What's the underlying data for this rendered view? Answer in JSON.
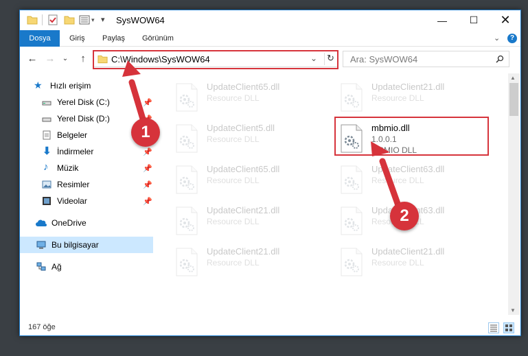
{
  "window": {
    "title": "SysWOW64"
  },
  "ribbon": {
    "tabs": [
      "Dosya",
      "Giriş",
      "Paylaş",
      "Görünüm"
    ]
  },
  "address": {
    "path": "C:\\Windows\\SysWOW64"
  },
  "search": {
    "placeholder": "Ara: SysWOW64"
  },
  "sidebar": {
    "items": [
      {
        "label": "Hızlı erişim",
        "icon": "star-icon",
        "pinned": false
      },
      {
        "label": "Yerel Disk (C:)",
        "icon": "drive-icon",
        "pinned": true
      },
      {
        "label": "Yerel Disk (D:)",
        "icon": "drive-icon",
        "pinned": true
      },
      {
        "label": "Belgeler",
        "icon": "documents-icon",
        "pinned": true
      },
      {
        "label": "İndirmeler",
        "icon": "download-icon",
        "pinned": true
      },
      {
        "label": "Müzik",
        "icon": "music-icon",
        "pinned": true
      },
      {
        "label": "Resimler",
        "icon": "pictures-icon",
        "pinned": true
      },
      {
        "label": "Videolar",
        "icon": "videos-icon",
        "pinned": true
      },
      {
        "label": "OneDrive",
        "icon": "cloud-icon",
        "pinned": false
      },
      {
        "label": "Bu bilgisayar",
        "icon": "computer-icon",
        "pinned": false,
        "selected": true
      },
      {
        "label": "Ağ",
        "icon": "network-icon",
        "pinned": false
      }
    ]
  },
  "files": [
    {
      "name": "UpdateClient65.dll",
      "type": "Resource DLL",
      "version": "",
      "faded": true
    },
    {
      "name": "UpdateClient21.dll",
      "type": "Resource DLL",
      "version": "",
      "faded": true
    },
    {
      "name": "UpdateClient5.dll",
      "type": "Resource DLL",
      "version": "",
      "faded": true
    },
    {
      "name": "mbmio.dll",
      "type": "MBMIO DLL",
      "version": "1.0.0.1",
      "faded": false
    },
    {
      "name": "UpdateClient65.dll",
      "type": "Resource DLL",
      "version": "",
      "faded": true
    },
    {
      "name": "UpdateClient63.dll",
      "type": "Resource DLL",
      "version": "",
      "faded": true
    },
    {
      "name": "UpdateClient21.dll",
      "type": "Resource DLL",
      "version": "",
      "faded": true
    },
    {
      "name": "UpdateClient63.dll",
      "type": "Resource DLL",
      "version": "",
      "faded": true
    },
    {
      "name": "UpdateClient21.dll",
      "type": "Resource DLL",
      "version": "",
      "faded": true
    },
    {
      "name": "UpdateClient21.dll",
      "type": "Resource DLL",
      "version": "",
      "faded": true
    }
  ],
  "status": {
    "count": "167 öğe"
  },
  "annotations": {
    "step1": "1",
    "step2": "2",
    "color": "#d6333b"
  }
}
